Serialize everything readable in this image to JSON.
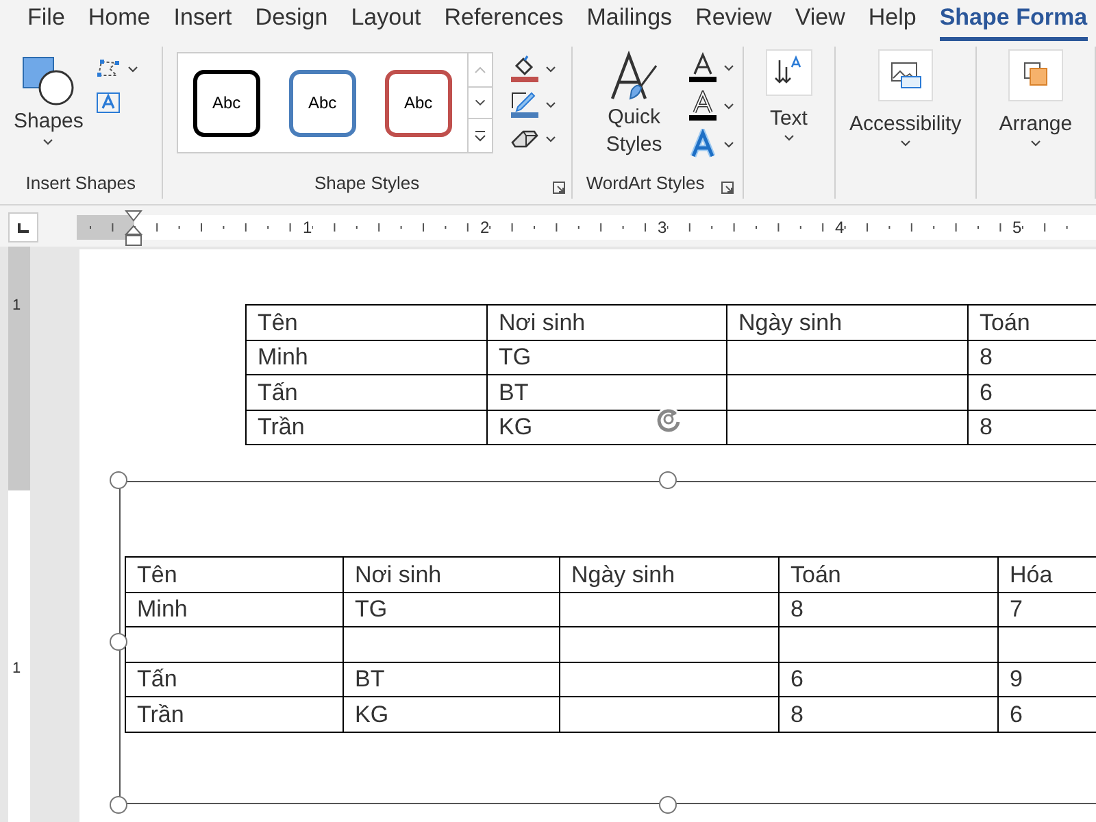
{
  "tabs": [
    {
      "label": "File",
      "selected": false
    },
    {
      "label": "Home",
      "selected": false
    },
    {
      "label": "Insert",
      "selected": false
    },
    {
      "label": "Design",
      "selected": false
    },
    {
      "label": "Layout",
      "selected": false
    },
    {
      "label": "References",
      "selected": false
    },
    {
      "label": "Mailings",
      "selected": false
    },
    {
      "label": "Review",
      "selected": false
    },
    {
      "label": "View",
      "selected": false
    },
    {
      "label": "Help",
      "selected": false
    },
    {
      "label": "Shape Forma",
      "selected": true
    }
  ],
  "ribbon": {
    "insert_shapes": {
      "shapes_button": "Shapes",
      "group_label": "Insert Shapes"
    },
    "shape_styles": {
      "styles": [
        {
          "label": "Abc",
          "color": "#000000"
        },
        {
          "label": "Abc",
          "color": "#4a7ebb"
        },
        {
          "label": "Abc",
          "color": "#c0504d"
        }
      ],
      "group_label": "Shape Styles"
    },
    "wordart_styles": {
      "quick_styles_button": "Quick Styles",
      "group_label": "WordArt Styles"
    },
    "text_button": "Text",
    "accessibility_button": "Accessibility",
    "arrange_button": "Arrange"
  },
  "ruler": {
    "numbers": [
      "1",
      "2",
      "3",
      "4",
      "5"
    ]
  },
  "vertical_ruler": {
    "numbers": [
      "1",
      "1"
    ]
  },
  "document": {
    "table": {
      "columns": [
        "Tên",
        "Nơi sinh",
        "Ngày sinh",
        "Toán"
      ],
      "rows": [
        [
          "Minh",
          "TG",
          null,
          "8"
        ],
        [
          "Tấn",
          "BT",
          null,
          "6"
        ],
        [
          "Trần",
          "KG",
          null,
          "8"
        ]
      ]
    },
    "text_box": {
      "selected": true,
      "table": {
        "columns": [
          "Tên",
          "Nơi sinh",
          "Ngày sinh",
          "Toán",
          "Hóa"
        ],
        "rows": [
          [
            "Minh",
            "TG",
            null,
            "8",
            "7"
          ],
          [
            null,
            null,
            null,
            null,
            null
          ],
          [
            "Tấn",
            "BT",
            null,
            "6",
            "9"
          ],
          [
            "Trần",
            "KG",
            null,
            "8",
            "6"
          ]
        ]
      }
    }
  }
}
